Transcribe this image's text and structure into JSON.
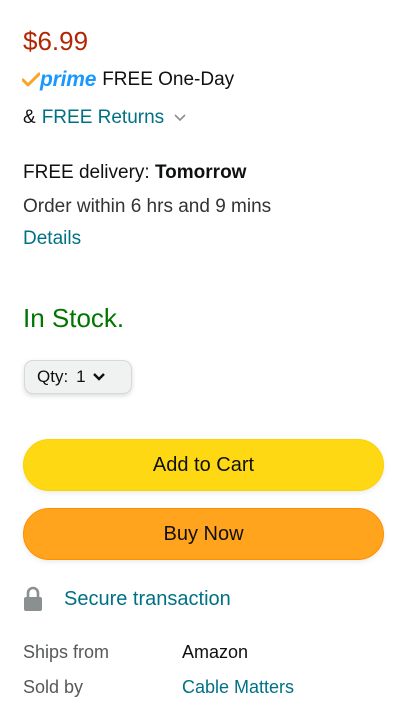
{
  "price": "$6.99",
  "prime": {
    "logo_text": "prime",
    "shipping_text": "FREE One-Day"
  },
  "returns": {
    "prefix": "&",
    "link": "FREE Returns"
  },
  "delivery": {
    "label": "FREE delivery:",
    "date": "Tomorrow",
    "order_within": "Order within 6 hrs and 9 mins",
    "details_link": "Details"
  },
  "stock_status": "In Stock.",
  "quantity": {
    "label": "Qty:",
    "value": "1"
  },
  "buttons": {
    "add_to_cart": "Add to Cart",
    "buy_now": "Buy Now"
  },
  "secure": {
    "label": "Secure transaction"
  },
  "ships_from": {
    "label": "Ships from",
    "value": "Amazon"
  },
  "sold_by": {
    "label": "Sold by",
    "value": "Cable Matters"
  },
  "colors": {
    "price": "#b12704",
    "link": "#007185",
    "in_stock": "#007600",
    "add_to_cart": "#ffd814",
    "buy_now": "#ffa41c",
    "prime_blue": "#1a98ff",
    "prime_check": "#f7a428"
  },
  "icons": {
    "prime": "prime-check-icon",
    "returns_chevron": "chevron-down-icon",
    "qty_chevron": "chevron-down-icon",
    "lock": "lock-icon"
  }
}
